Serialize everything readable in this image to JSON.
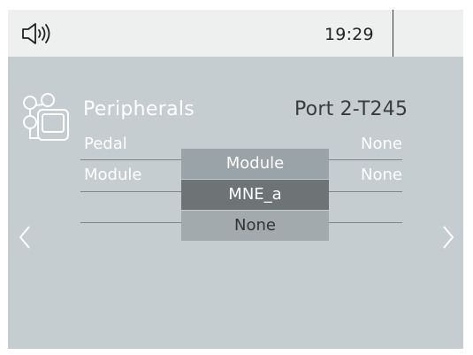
{
  "status_bar": {
    "icon": "speaker-volume-icon",
    "time": "19:29"
  },
  "header": {
    "icon": "peripherals-icon",
    "title": "Peripherals",
    "port": "Port 2-T245"
  },
  "rows": [
    {
      "label": "Pedal",
      "value": "None"
    },
    {
      "label": "Module",
      "value": "None"
    }
  ],
  "picker": {
    "options": [
      "Module",
      "MNE_a",
      "None"
    ],
    "selected": "MNE_a"
  },
  "navigation": {
    "prev_icon": "chevron-left-icon",
    "next_icon": "chevron-right-icon"
  },
  "colors": {
    "screen_background": "#c5cdd0",
    "status_bar_background": "#eef0f0",
    "picker_option": "#9aa3a7",
    "picker_selected": "#6e7376"
  }
}
